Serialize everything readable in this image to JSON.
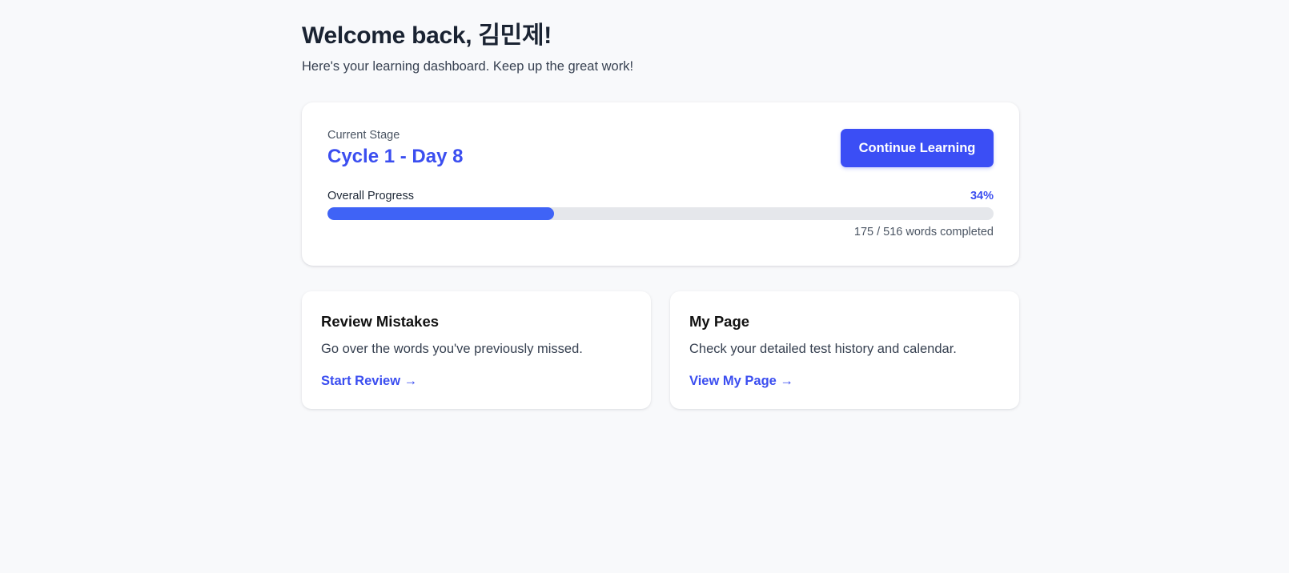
{
  "header": {
    "title": "Welcome back, 김민제!",
    "subtitle": "Here's your learning dashboard. Keep up the great work!"
  },
  "stage_card": {
    "label": "Current Stage",
    "value": "Cycle 1 - Day 8",
    "continue_label": "Continue Learning",
    "progress": {
      "label": "Overall Progress",
      "percent_text": "34%",
      "fraction": 0.34,
      "count_text": "175 / 516 words completed"
    }
  },
  "cards": {
    "review": {
      "title": "Review Mistakes",
      "description": "Go over the words you've previously missed.",
      "link": "Start Review →"
    },
    "mypage": {
      "title": "My Page",
      "description": "Check your detailed test history and calendar.",
      "link": "View My Page →"
    }
  },
  "colors": {
    "accent": "#3b4ef0",
    "progress_fill": "#3f63f6",
    "progress_track": "#e5e7eb",
    "background": "#f8f9fb"
  }
}
